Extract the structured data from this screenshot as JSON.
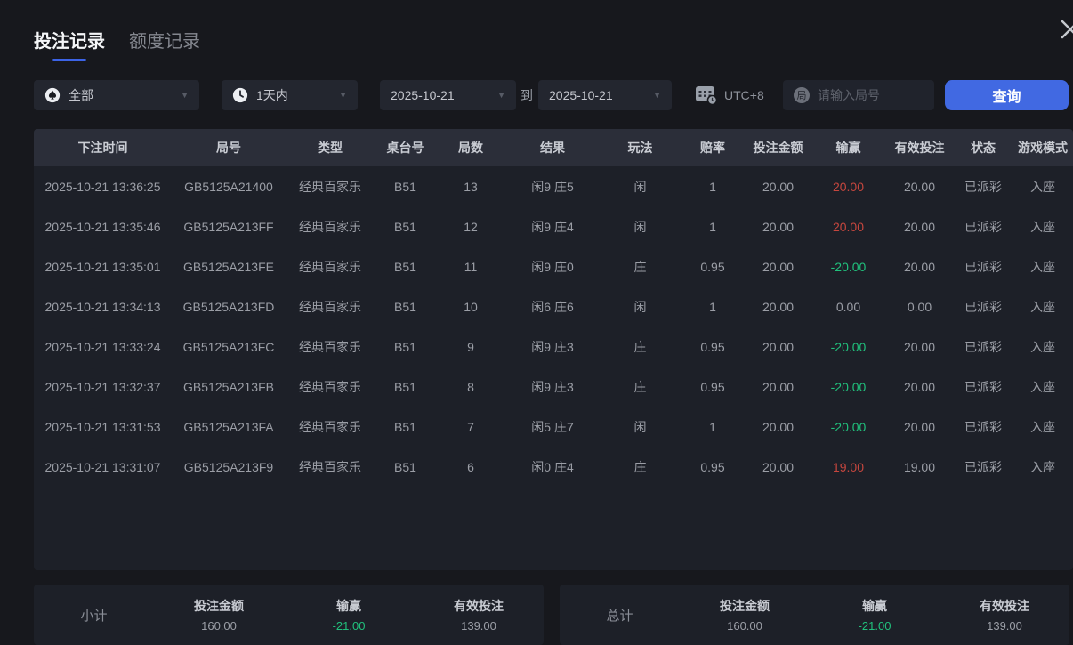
{
  "tabs": [
    {
      "label": "投注记录",
      "active": true
    },
    {
      "label": "额度记录",
      "active": false
    }
  ],
  "close_icon": "close",
  "filters": {
    "game_type": {
      "icon": "spade-icon",
      "value": "全部"
    },
    "time_range": {
      "icon": "clock-icon",
      "value": "1天内"
    },
    "date_from": "2025-10-21",
    "to_label": "到",
    "date_to": "2025-10-21",
    "timezone_icon": "calendar-clock-icon",
    "timezone": "UTC+8",
    "round_input": {
      "icon_char": "局",
      "placeholder": "请输入局号",
      "value": ""
    },
    "query_button": "查询"
  },
  "table": {
    "columns": [
      "下注时间",
      "局号",
      "类型",
      "桌台号",
      "局数",
      "结果",
      "玩法",
      "赔率",
      "投注金额",
      "输赢",
      "有效投注",
      "状态",
      "游戏模式"
    ],
    "column_keys": [
      "time",
      "round_id",
      "type",
      "table_no",
      "round",
      "result",
      "play",
      "odds",
      "bet",
      "win_loss",
      "valid",
      "status",
      "mode"
    ],
    "rows": [
      {
        "time": "2025-10-21 13:36:25",
        "round_id": "GB5125A21400",
        "type": "经典百家乐",
        "table_no": "B51",
        "round": "13",
        "result": "闲9 庄5",
        "play": "闲",
        "odds": "1",
        "bet": "20.00",
        "win_loss": "20.00",
        "win_loss_color": "red",
        "valid": "20.00",
        "status": "已派彩",
        "mode": "入座"
      },
      {
        "time": "2025-10-21 13:35:46",
        "round_id": "GB5125A213FF",
        "type": "经典百家乐",
        "table_no": "B51",
        "round": "12",
        "result": "闲9 庄4",
        "play": "闲",
        "odds": "1",
        "bet": "20.00",
        "win_loss": "20.00",
        "win_loss_color": "red",
        "valid": "20.00",
        "status": "已派彩",
        "mode": "入座"
      },
      {
        "time": "2025-10-21 13:35:01",
        "round_id": "GB5125A213FE",
        "type": "经典百家乐",
        "table_no": "B51",
        "round": "11",
        "result": "闲9 庄0",
        "play": "庄",
        "odds": "0.95",
        "bet": "20.00",
        "win_loss": "-20.00",
        "win_loss_color": "green",
        "valid": "20.00",
        "status": "已派彩",
        "mode": "入座"
      },
      {
        "time": "2025-10-21 13:34:13",
        "round_id": "GB5125A213FD",
        "type": "经典百家乐",
        "table_no": "B51",
        "round": "10",
        "result": "闲6 庄6",
        "play": "闲",
        "odds": "1",
        "bet": "20.00",
        "win_loss": "0.00",
        "win_loss_color": "gray",
        "valid": "0.00",
        "status": "已派彩",
        "mode": "入座"
      },
      {
        "time": "2025-10-21 13:33:24",
        "round_id": "GB5125A213FC",
        "type": "经典百家乐",
        "table_no": "B51",
        "round": "9",
        "result": "闲9 庄3",
        "play": "庄",
        "odds": "0.95",
        "bet": "20.00",
        "win_loss": "-20.00",
        "win_loss_color": "green",
        "valid": "20.00",
        "status": "已派彩",
        "mode": "入座"
      },
      {
        "time": "2025-10-21 13:32:37",
        "round_id": "GB5125A213FB",
        "type": "经典百家乐",
        "table_no": "B51",
        "round": "8",
        "result": "闲9 庄3",
        "play": "庄",
        "odds": "0.95",
        "bet": "20.00",
        "win_loss": "-20.00",
        "win_loss_color": "green",
        "valid": "20.00",
        "status": "已派彩",
        "mode": "入座"
      },
      {
        "time": "2025-10-21 13:31:53",
        "round_id": "GB5125A213FA",
        "type": "经典百家乐",
        "table_no": "B51",
        "round": "7",
        "result": "闲5 庄7",
        "play": "闲",
        "odds": "1",
        "bet": "20.00",
        "win_loss": "-20.00",
        "win_loss_color": "green",
        "valid": "20.00",
        "status": "已派彩",
        "mode": "入座"
      },
      {
        "time": "2025-10-21 13:31:07",
        "round_id": "GB5125A213F9",
        "type": "经典百家乐",
        "table_no": "B51",
        "round": "6",
        "result": "闲0 庄4",
        "play": "庄",
        "odds": "0.95",
        "bet": "20.00",
        "win_loss": "19.00",
        "win_loss_color": "red",
        "valid": "19.00",
        "status": "已派彩",
        "mode": "入座"
      }
    ]
  },
  "summary": {
    "panels": [
      {
        "name": "subtotal",
        "label": "小计",
        "stats": [
          {
            "label": "投注金额",
            "value": "160.00",
            "color": "gray"
          },
          {
            "label": "输赢",
            "value": "-21.00",
            "color": "green"
          },
          {
            "label": "有效投注",
            "value": "139.00",
            "color": "gray"
          }
        ]
      },
      {
        "name": "total",
        "label": "总计",
        "stats": [
          {
            "label": "投注金额",
            "value": "160.00",
            "color": "gray"
          },
          {
            "label": "输赢",
            "value": "-21.00",
            "color": "green"
          },
          {
            "label": "有效投注",
            "value": "139.00",
            "color": "gray"
          }
        ]
      }
    ]
  },
  "colors": {
    "accent_blue": "#4169e2",
    "win_red": "#c5463e",
    "loss_green": "#21c07c",
    "page_bg": "#17181d",
    "panel_bg": "#1d2028",
    "header_bg": "#2b2e39"
  }
}
